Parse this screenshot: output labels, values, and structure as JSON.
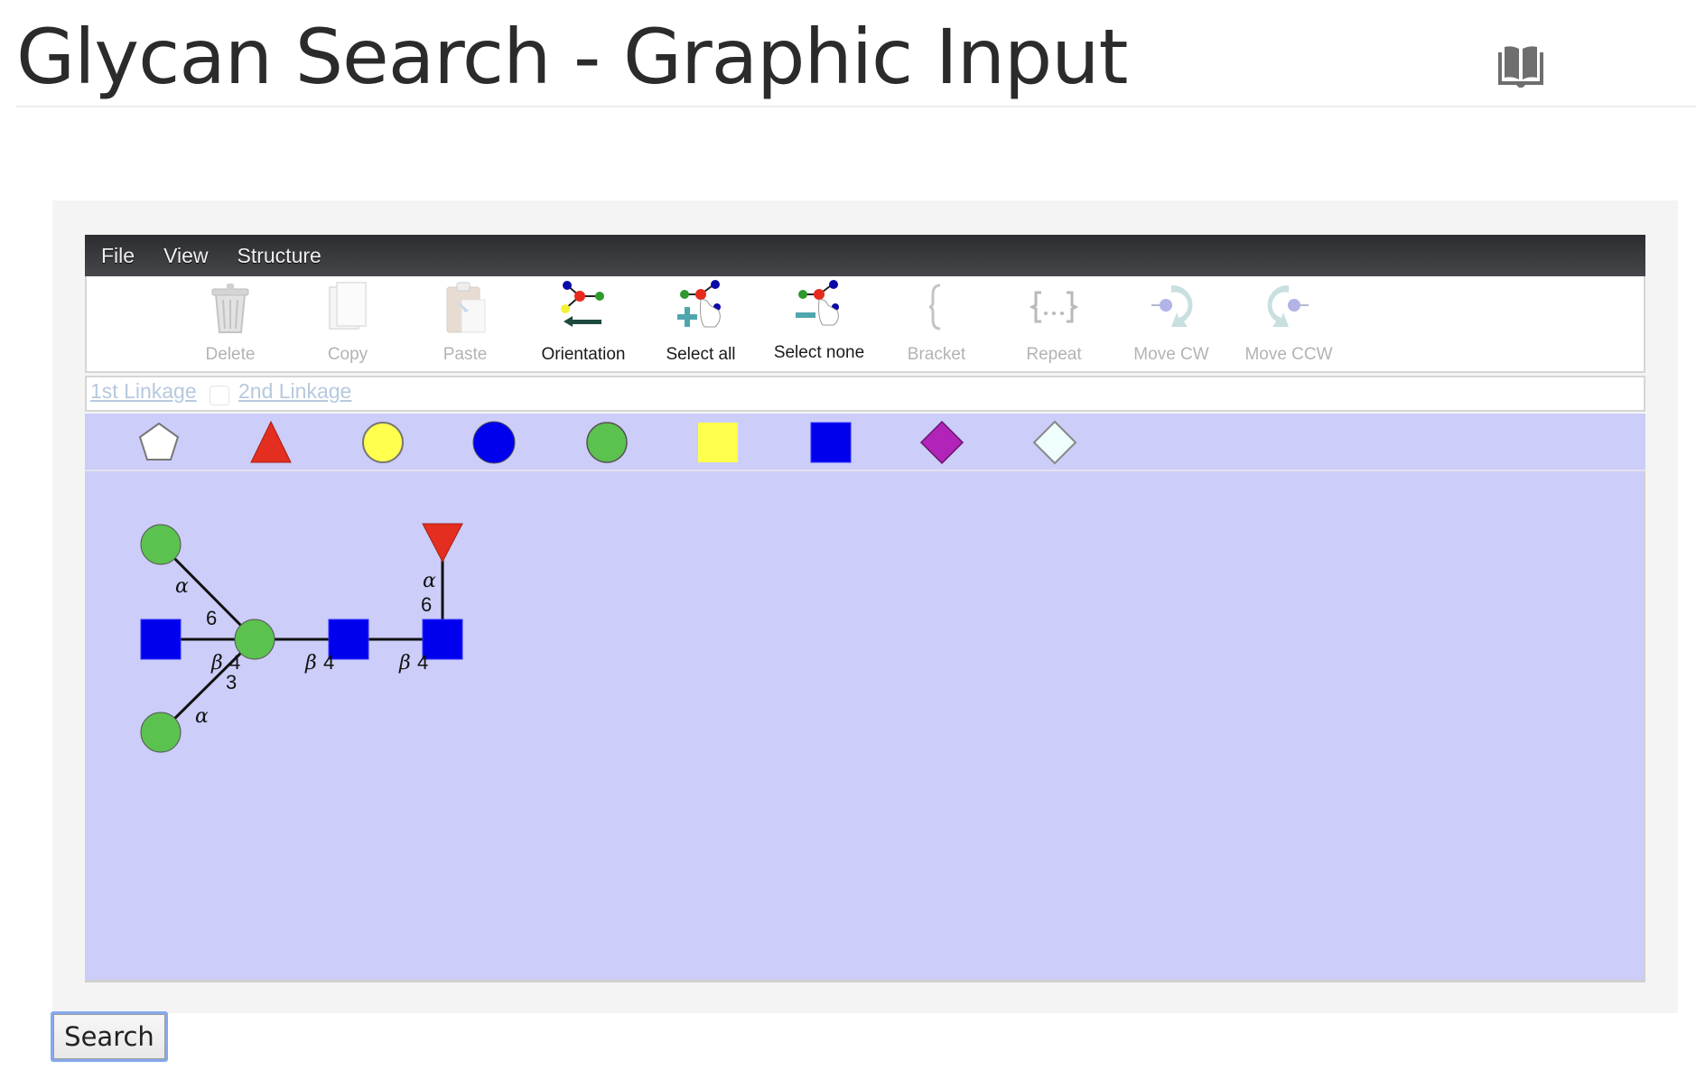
{
  "page": {
    "title": "Glycan Search - Graphic Input",
    "help_icon": "book-icon"
  },
  "editor": {
    "menu": [
      {
        "label": "File"
      },
      {
        "label": "View"
      },
      {
        "label": "Structure"
      }
    ],
    "toolbar": [
      {
        "label": "Delete",
        "icon": "trash-icon",
        "enabled": false
      },
      {
        "label": "Copy",
        "icon": "copy-icon",
        "enabled": false
      },
      {
        "label": "Paste",
        "icon": "paste-icon",
        "enabled": false
      },
      {
        "label": "Orientation",
        "icon": "orientation-icon",
        "enabled": true
      },
      {
        "label": "Select all",
        "icon": "select-all-icon",
        "enabled": true
      },
      {
        "label": "Select none",
        "icon": "select-none-icon",
        "enabled": true
      },
      {
        "label": "Bracket",
        "icon": "bracket-icon",
        "enabled": false
      },
      {
        "label": "Repeat",
        "icon": "repeat-icon",
        "enabled": false
      },
      {
        "label": "Move CW",
        "icon": "rotate-cw-icon",
        "enabled": false
      },
      {
        "label": "Move CCW",
        "icon": "rotate-ccw-icon",
        "enabled": false
      }
    ],
    "linkage": {
      "first_label": "1st Linkage",
      "second_label": "2nd Linkage",
      "checkbox_checked": false
    },
    "palette": [
      {
        "shape": "pentagon",
        "fill": "#ffffff",
        "stroke": "#777777"
      },
      {
        "shape": "triangle",
        "fill": "#e42e1f",
        "stroke": "#a52015"
      },
      {
        "shape": "circle",
        "fill": "#ffff4d",
        "stroke": "#777777"
      },
      {
        "shape": "circle",
        "fill": "#0000ee",
        "stroke": "#555555"
      },
      {
        "shape": "circle",
        "fill": "#5bc24f",
        "stroke": "#555555"
      },
      {
        "shape": "square",
        "fill": "#ffff4d",
        "stroke": "#ffff4d"
      },
      {
        "shape": "square",
        "fill": "#0000ee",
        "stroke": "#3333ff"
      },
      {
        "shape": "diamond",
        "fill": "#b223b9",
        "stroke": "#6a156e"
      },
      {
        "shape": "diamond",
        "fill": "#eefffd",
        "stroke": "#888888"
      }
    ],
    "glycan": {
      "residues": [
        {
          "id": "r1",
          "shape": "square",
          "fill": "#0000ee"
        },
        {
          "id": "r2",
          "shape": "square",
          "fill": "#0000ee"
        },
        {
          "id": "r3",
          "shape": "circle",
          "fill": "#5bc24f"
        },
        {
          "id": "r4",
          "shape": "circle",
          "fill": "#5bc24f"
        },
        {
          "id": "r5",
          "shape": "circle",
          "fill": "#5bc24f"
        },
        {
          "id": "r6",
          "shape": "square",
          "fill": "#0000ee"
        },
        {
          "id": "f1",
          "shape": "triangle",
          "fill": "#e42e1f"
        }
      ],
      "linkages": [
        {
          "from": "r2",
          "to": "r1",
          "anomer": "β",
          "position": "4"
        },
        {
          "from": "r3",
          "to": "r2",
          "anomer": "β",
          "position": "4"
        },
        {
          "from": "r4",
          "to": "r3",
          "anomer": "α",
          "position": "6"
        },
        {
          "from": "r5",
          "to": "r3",
          "anomer": "α",
          "position": "3"
        },
        {
          "from": "r6",
          "to": "r3",
          "anomer": "β",
          "position": "4"
        },
        {
          "from": "f1",
          "to": "r1",
          "anomer": "α",
          "position": "6"
        }
      ]
    }
  },
  "search_button": {
    "label": "Search"
  }
}
